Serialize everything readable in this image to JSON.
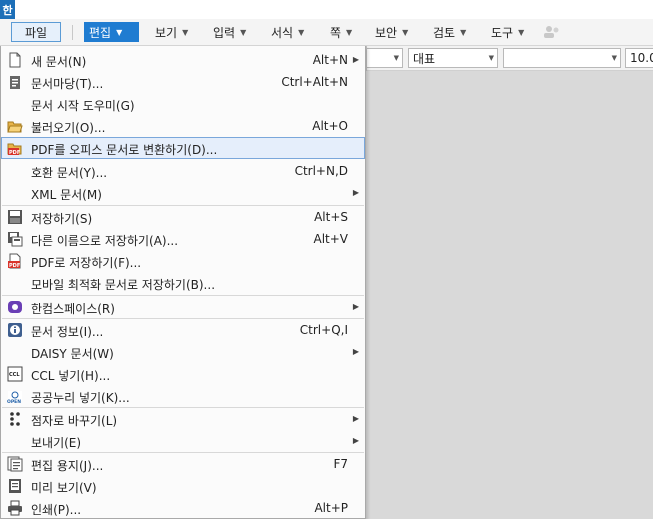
{
  "app": {
    "logo": "한"
  },
  "menubar": {
    "file": "파일",
    "items": [
      "편집",
      "보기",
      "입력",
      "서식",
      "쪽",
      "보안",
      "검토",
      "도구"
    ]
  },
  "toolbar": {
    "style_value": "대표",
    "font_value": "",
    "size_value": "10.0"
  },
  "file_menu": {
    "items": [
      {
        "label": "새 문서(N)",
        "shortcut": "Alt+N",
        "submenu": true,
        "icon": "new-document-icon"
      },
      {
        "label": "문서마당(T)...",
        "shortcut": "Ctrl+Alt+N",
        "submenu": false,
        "icon": "template-icon"
      },
      {
        "label": "문서 시작 도우미(G)",
        "shortcut": "",
        "submenu": false,
        "icon": ""
      },
      {
        "label": "불러오기(O)...",
        "shortcut": "Alt+O",
        "submenu": false,
        "icon": "folder-open-icon"
      },
      {
        "label": "PDF를 오피스 문서로 변환하기(D)...",
        "shortcut": "",
        "submenu": false,
        "icon": "pdf-convert-icon"
      },
      {
        "label": "호환 문서(Y)...",
        "shortcut": "Ctrl+N,D",
        "submenu": false,
        "icon": ""
      },
      {
        "label": "XML 문서(M)",
        "shortcut": "",
        "submenu": true,
        "icon": ""
      },
      {
        "label": "저장하기(S)",
        "shortcut": "Alt+S",
        "submenu": false,
        "icon": "save-icon"
      },
      {
        "label": "다른 이름으로 저장하기(A)...",
        "shortcut": "Alt+V",
        "submenu": false,
        "icon": "save-as-icon"
      },
      {
        "label": "PDF로 저장하기(F)...",
        "shortcut": "",
        "submenu": false,
        "icon": "pdf-save-icon"
      },
      {
        "label": "모바일 최적화 문서로 저장하기(B)...",
        "shortcut": "",
        "submenu": false,
        "icon": ""
      },
      {
        "label": "한컴스페이스(R)",
        "shortcut": "",
        "submenu": true,
        "icon": "hancom-space-icon"
      },
      {
        "label": "문서 정보(I)...",
        "shortcut": "Ctrl+Q,I",
        "submenu": false,
        "icon": "info-icon"
      },
      {
        "label": "DAISY 문서(W)",
        "shortcut": "",
        "submenu": true,
        "icon": ""
      },
      {
        "label": "CCL 넣기(H)...",
        "shortcut": "",
        "submenu": false,
        "icon": "ccl-icon"
      },
      {
        "label": "공공누리 넣기(K)...",
        "shortcut": "",
        "submenu": false,
        "icon": "kogl-icon"
      },
      {
        "label": "점자로 바꾸기(L)",
        "shortcut": "",
        "submenu": true,
        "icon": "braille-icon"
      },
      {
        "label": "보내기(E)",
        "shortcut": "",
        "submenu": true,
        "icon": ""
      },
      {
        "label": "편집 용지(J)...",
        "shortcut": "F7",
        "submenu": false,
        "icon": "page-setup-icon"
      },
      {
        "label": "미리 보기(V)",
        "shortcut": "",
        "submenu": false,
        "icon": "preview-icon"
      },
      {
        "label": "인쇄(P)...",
        "shortcut": "Alt+P",
        "submenu": false,
        "icon": "print-icon"
      }
    ],
    "highlighted": "PDF를 오피스 문서로 변환하기(D)..."
  },
  "colors": {
    "accent": "#1f7cd1",
    "highlight_bg": "#e5eefb",
    "highlight_border": "#7aa7db"
  }
}
